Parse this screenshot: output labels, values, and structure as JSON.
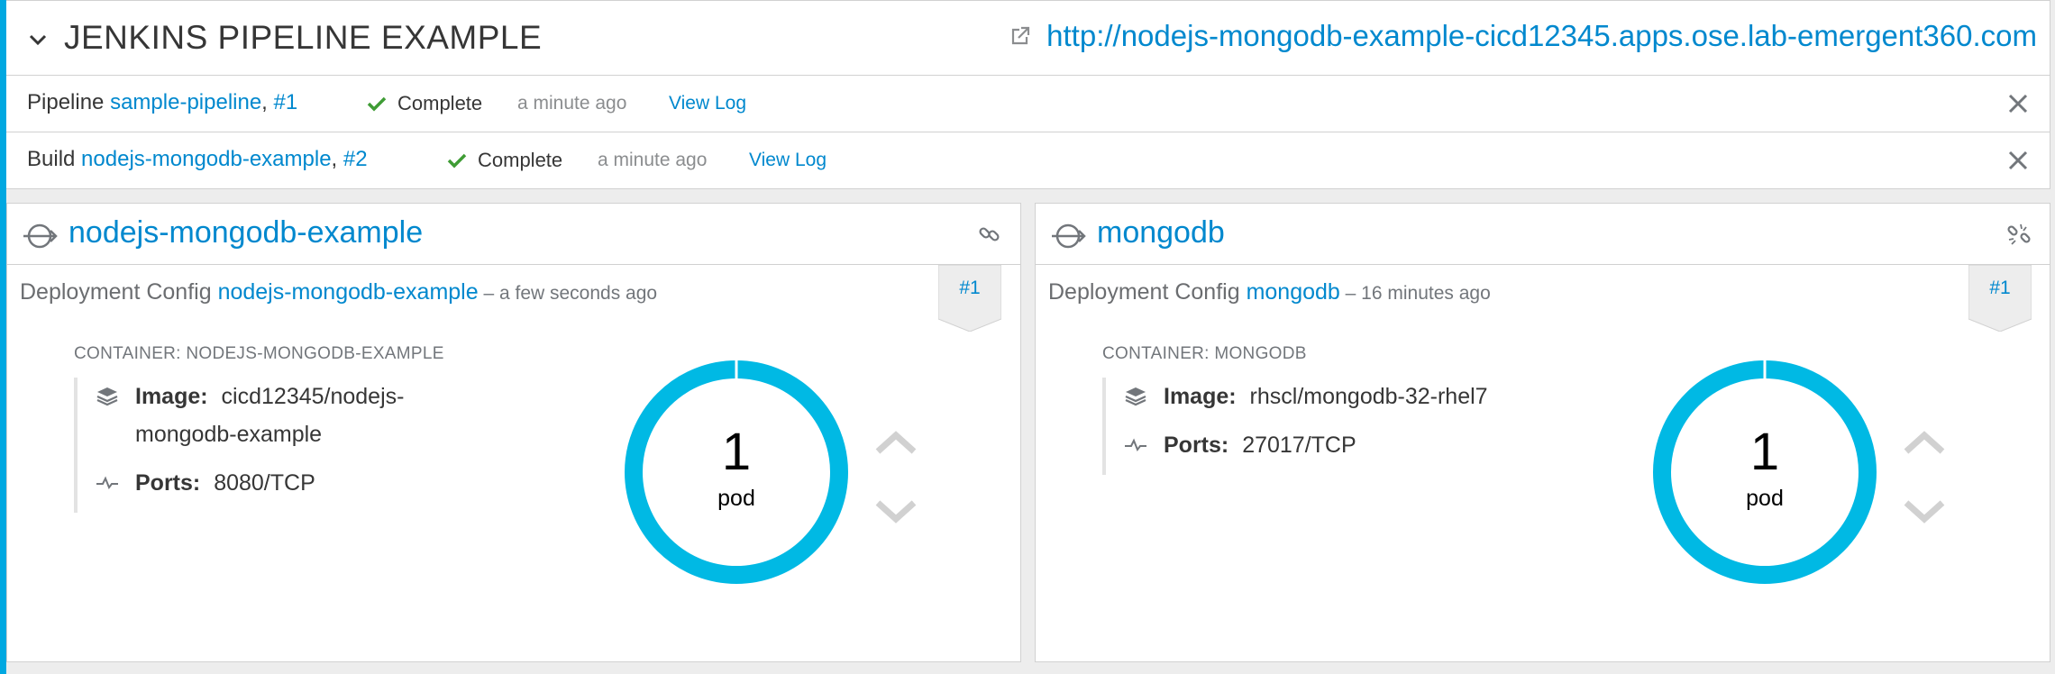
{
  "app": {
    "title": "JENKINS PIPELINE EXAMPLE",
    "route_url": "http://nodejs-mongodb-example-cicd12345.apps.ose.lab-emergent360.com"
  },
  "pipeline_row": {
    "prefix": "Pipeline",
    "name": "sample-pipeline",
    "sep": ", ",
    "number": "#1",
    "status": "Complete",
    "time": "a minute ago",
    "view_log": "View Log"
  },
  "build_row": {
    "prefix": "Build",
    "name": "nodejs-mongodb-example",
    "sep": ", ",
    "number": "#2",
    "status": "Complete",
    "time": "a minute ago",
    "view_log": "View Log"
  },
  "services": [
    {
      "name": "nodejs-mongodb-example",
      "dc_prefix": "Deployment Config ",
      "dc_name": "nodejs-mongodb-example",
      "dc_time": " – a few seconds ago",
      "revision": "#1",
      "container_label": "CONTAINER: NODEJS-MONGODB-EXAMPLE",
      "image_label": "Image:",
      "image_value_1": "cicd12345/nodejs-",
      "image_value_2": "mongodb-example",
      "ports_label": "Ports:",
      "ports_value": "8080/TCP",
      "pod_count": "1",
      "pod_unit": "pod"
    },
    {
      "name": "mongodb",
      "dc_prefix": "Deployment Config ",
      "dc_name": "mongodb",
      "dc_time": " – 16 minutes ago",
      "revision": "#1",
      "container_label": "CONTAINER: MONGODB",
      "image_label": "Image:",
      "image_value_1": "rhscl/mongodb-32-rhel7",
      "ports_label": "Ports:",
      "ports_value": "27017/TCP",
      "pod_count": "1",
      "pod_unit": "pod"
    }
  ],
  "icons": {
    "collapse": "chevron-down-icon",
    "external_link": "external-link-icon",
    "status": "check-icon",
    "close": "close-icon",
    "service": "service-icon",
    "link": "link-icon",
    "unlink": "unlink-icon",
    "image": "layers-icon",
    "ports": "pulse-icon",
    "scale_up": "chevron-up-icon",
    "scale_down": "chevron-down-icon"
  },
  "colors": {
    "accent": "#00a8e1",
    "link": "#0088ce",
    "success": "#3f9c35",
    "donut": "#00b9e4"
  }
}
